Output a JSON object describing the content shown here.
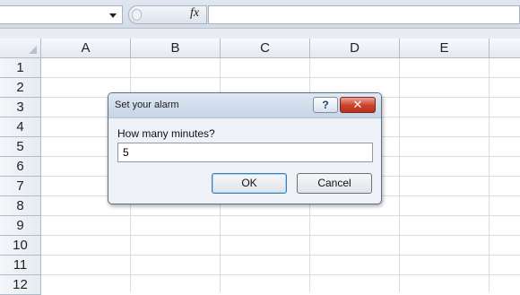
{
  "formula_bar": {
    "name_box_value": "",
    "fx_symbol": "fx",
    "formula_value": ""
  },
  "sheet": {
    "columns": [
      "A",
      "B",
      "C",
      "D",
      "E"
    ],
    "rows": [
      "1",
      "2",
      "3",
      "4",
      "5",
      "6",
      "7",
      "8",
      "9",
      "10",
      "11",
      "12"
    ]
  },
  "dialog": {
    "title": "Set your alarm",
    "help_label": "?",
    "close_label": "✕",
    "prompt": "How many minutes?",
    "input_value": "5",
    "ok_label": "OK",
    "cancel_label": "Cancel"
  },
  "colors": {
    "close_button": "#c7412b",
    "default_button_border": "#3c7fb1",
    "dialog_border": "#5c6f86"
  }
}
